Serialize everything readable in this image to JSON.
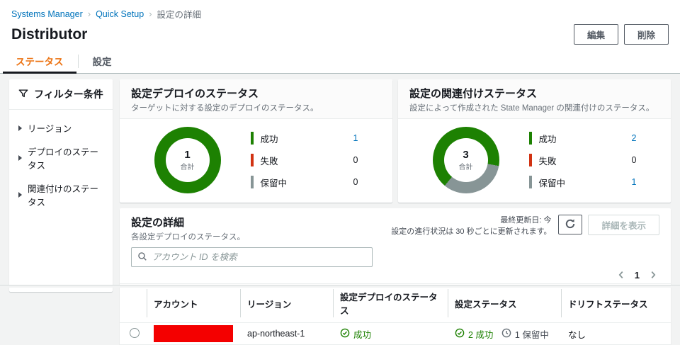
{
  "breadcrumb": {
    "items": [
      {
        "label": "Systems Manager"
      },
      {
        "label": "Quick Setup"
      },
      {
        "label": "設定の詳細"
      }
    ]
  },
  "page": {
    "title": "Distributor"
  },
  "actions": {
    "edit": "編集",
    "delete": "削除"
  },
  "tabs": {
    "status": "ステータス",
    "settings": "設定"
  },
  "filters": {
    "title": "フィルター条件",
    "items": [
      {
        "label": "リージョン"
      },
      {
        "label": "デプロイのステータス"
      },
      {
        "label": "関連付けのステータス"
      }
    ]
  },
  "chart_data": [
    {
      "type": "pie",
      "variant": "donut",
      "title": "設定デプロイのステータス",
      "subtitle": "ターゲットに対する設定のデプロイのステータス。",
      "center": {
        "value": 1,
        "label": "合計"
      },
      "legend_position": "right",
      "segments": [
        {
          "label": "成功",
          "value": 1,
          "color": "#1d8102"
        },
        {
          "label": "失敗",
          "value": 0,
          "color": "#d13212"
        },
        {
          "label": "保留中",
          "value": 0,
          "color": "#879596"
        }
      ]
    },
    {
      "type": "pie",
      "variant": "donut",
      "title": "設定の関連付けステータス",
      "subtitle": "設定によって作成された State Manager の関連付けのステータス。",
      "center": {
        "value": 3,
        "label": "合計"
      },
      "legend_position": "right",
      "segments": [
        {
          "label": "成功",
          "value": 2,
          "color": "#1d8102"
        },
        {
          "label": "失敗",
          "value": 0,
          "color": "#d13212"
        },
        {
          "label": "保留中",
          "value": 1,
          "color": "#879596"
        }
      ]
    }
  ],
  "details": {
    "title": "設定の詳細",
    "subtitle": "各設定デプロイのステータス。",
    "last_updated": "最終更新日: 今",
    "refresh_note": "設定の進行状況は 30 秒ごとに更新されます。",
    "view_details_label": "詳細を表示",
    "search_placeholder": "アカウント ID を検索",
    "pagination": {
      "page": "1"
    },
    "table": {
      "columns": [
        "アカウント",
        "リージョン",
        "設定デプロイのステータス",
        "設定ステータス",
        "ドリフトステータス"
      ],
      "row": {
        "redaction_color": "#f40000",
        "region": "ap-northeast-1",
        "deploy_status": "成功",
        "config_status_success": "2 成功",
        "config_status_pending": "1 保留中",
        "drift_status": "なし"
      }
    }
  },
  "colors": {
    "tab_accent": "#ec7211",
    "link": "#0073bb",
    "success": "#1d8102",
    "error": "#d13212",
    "pending": "#879596"
  }
}
